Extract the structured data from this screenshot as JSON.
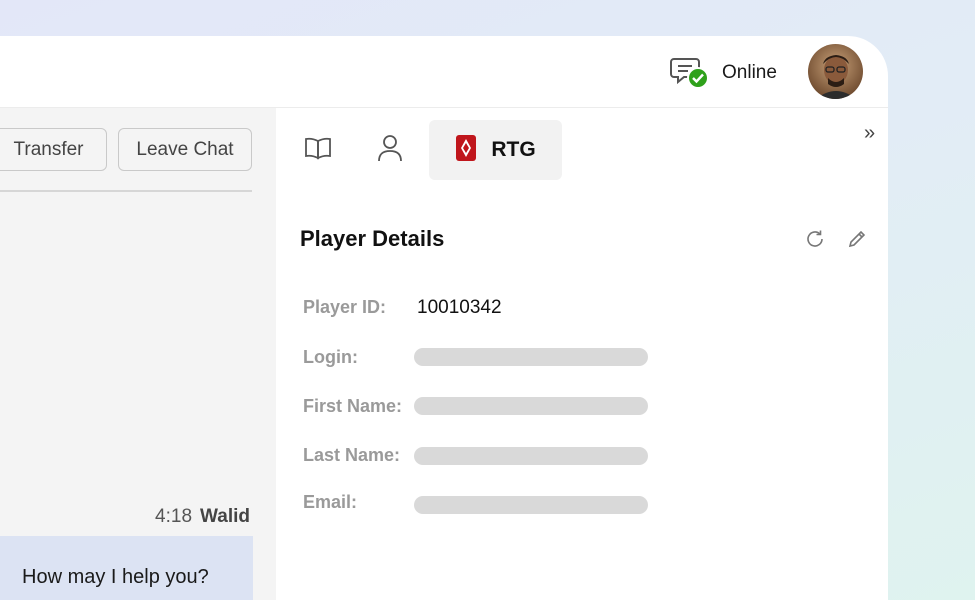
{
  "header": {
    "status_label": "Online",
    "status_color": "#2fa11b"
  },
  "chat": {
    "transfer_label": "Transfer",
    "leave_label": "Leave Chat",
    "message": {
      "time": "4:18",
      "author": "Walid",
      "text": "How may I help you?"
    }
  },
  "sidebar": {
    "tabs": [
      {
        "icon": "book-icon"
      },
      {
        "icon": "person-icon"
      },
      {
        "icon": "rtg-logo-icon",
        "label": "RTG"
      }
    ],
    "expand_glyph": "»",
    "section_title": "Player Details",
    "fields": [
      {
        "label": "Player ID:",
        "value": "10010342"
      },
      {
        "label": "Login:",
        "value": ""
      },
      {
        "label": "First Name:",
        "value": ""
      },
      {
        "label": "Last Name:",
        "value": ""
      },
      {
        "label": "Email:",
        "value": ""
      }
    ]
  },
  "colors": {
    "brand_red": "#c0161c",
    "bubble": "#dce3f3",
    "placeholder": "#d9d9d9"
  }
}
